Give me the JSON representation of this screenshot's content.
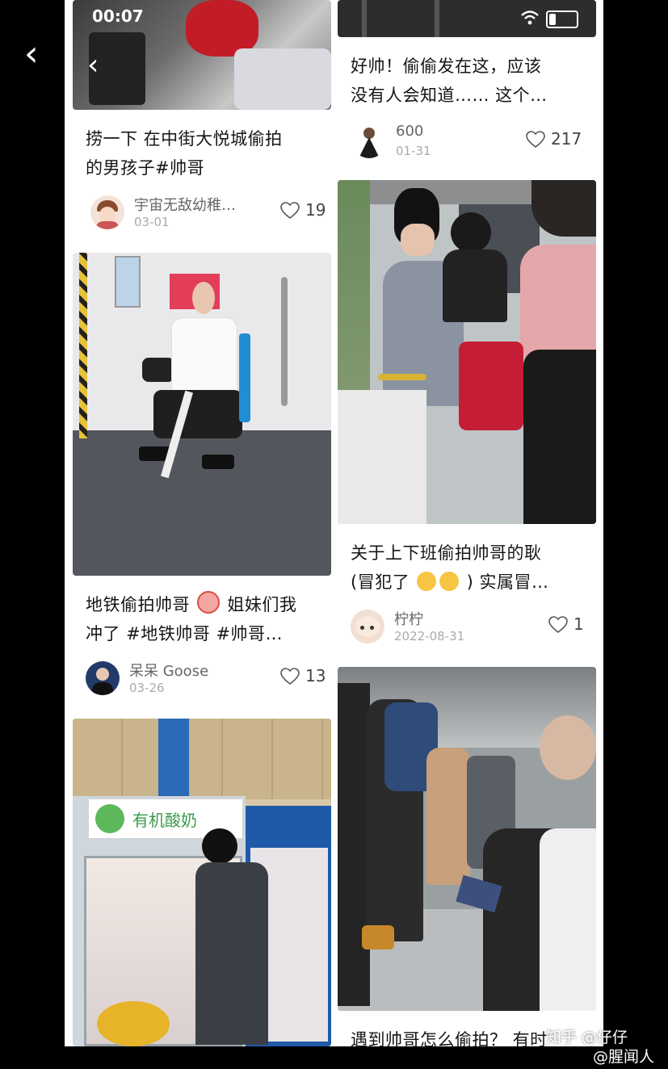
{
  "status_bar": {
    "time": "00:07"
  },
  "cards": [
    {
      "title_lines": [
        "捞一下 在中街大悦城偷拍",
        "的男孩子#帅哥"
      ],
      "author": "宇宙无敌幼稚…",
      "date": "03-01",
      "likes": "19"
    },
    {
      "title_lines": [
        "好帅！偷偷发在这，应该",
        "没有人会知道…… 这个…"
      ],
      "author": "600",
      "date": "01-31",
      "likes": "217"
    },
    {
      "title_lines": [
        "地铁偷拍帅哥",
        "姐妹们我",
        "冲了 #地铁帅哥 #帅哥…"
      ],
      "author": "呆呆 Goose",
      "date": "03-26",
      "likes": "13"
    },
    {
      "title_lines": [
        "关于上下班偷拍帅哥的耿",
        "(冒犯了",
        ") 实属冒…"
      ],
      "author": "柠柠",
      "date": "2022-08-31",
      "likes": "1"
    },
    {
      "title_lines": [
        "遇到帅哥怎么偷拍？ 有时"
      ]
    }
  ],
  "shop_signs": {
    "yogurt": "有机酸奶"
  },
  "watermarks": {
    "zhihu": "知乎 @仔仔",
    "weibo": "@腥闻人"
  },
  "icons": {
    "back": "chevron-left-icon",
    "like": "heart-outline-icon",
    "wifi": "wifi-icon",
    "battery": "battery-icon"
  },
  "colors": {
    "screen_bg": "#ffffff",
    "outer_bg": "#000000",
    "title_text": "#161616",
    "meta_text": "#999999"
  }
}
